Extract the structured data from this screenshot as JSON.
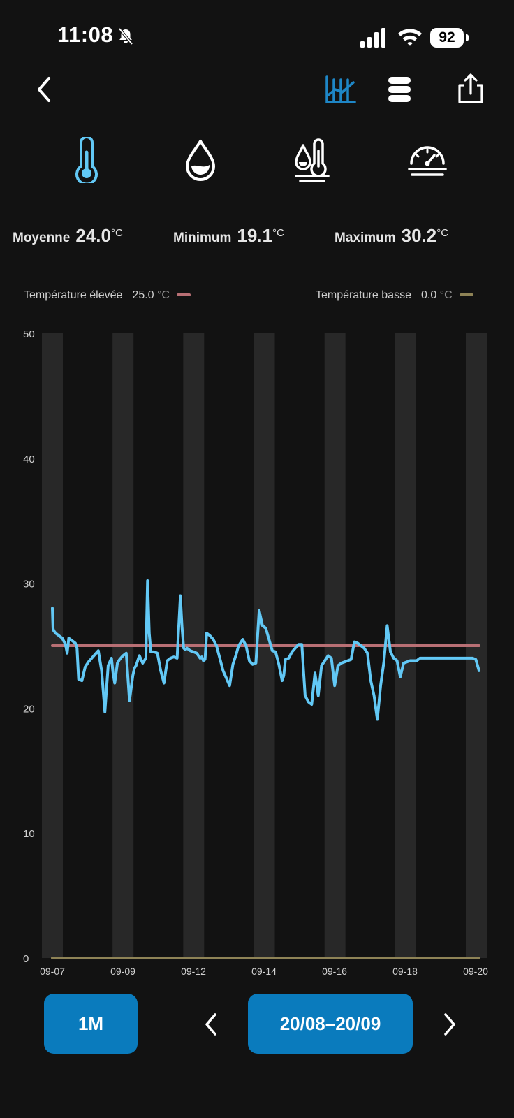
{
  "status_bar": {
    "time": "11:08",
    "battery": "92",
    "icons": [
      "bell-slash-icon",
      "cellular-signal-icon",
      "wifi-icon",
      "battery-icon"
    ]
  },
  "nav": {
    "icons": [
      "back-chevron-icon",
      "chart-view-icon",
      "list-view-icon",
      "share-icon"
    ]
  },
  "metric_tabs": [
    {
      "icon": "thermometer-icon",
      "active": true
    },
    {
      "icon": "water-drop-icon",
      "active": false
    },
    {
      "icon": "dew-point-icon",
      "active": false
    },
    {
      "icon": "gauge-icon",
      "active": false
    }
  ],
  "stats": {
    "avg": {
      "label": "Moyenne",
      "value": "24.0",
      "unit": "°C"
    },
    "min": {
      "label": "Minimum",
      "value": "19.1",
      "unit": "°C"
    },
    "max": {
      "label": "Maximum",
      "value": "30.2",
      "unit": "°C"
    }
  },
  "legend": {
    "high": {
      "label": "Température élevée",
      "value": "25.0",
      "unit": "°C",
      "color": "#b86f74"
    },
    "low": {
      "label": "Température basse",
      "value": "0.0",
      "unit": "°C",
      "color": "#8e8356"
    }
  },
  "controls": {
    "range": "1M",
    "date_range": "20/08–20/09"
  },
  "colors": {
    "accent": "#0a7bbd",
    "line": "#62c8f5",
    "band": "#282828",
    "background": "#121212"
  },
  "chart_data": {
    "type": "line",
    "ylim": [
      0,
      50
    ],
    "y_ticks": [
      "0",
      "10",
      "20",
      "30",
      "40",
      "50"
    ],
    "x_ticks": [
      "09-07",
      "09-09",
      "09-12",
      "09-14",
      "09-16",
      "09-18",
      "09-20"
    ],
    "thresholds": [
      {
        "value": 25.0,
        "color": "#b86f74"
      },
      {
        "value": 0.0,
        "color": "#8e8356"
      }
    ],
    "x_domain": [
      0,
      13
    ],
    "series": [
      {
        "x": [
          0,
          0.02,
          0.04,
          0.1,
          0.2,
          0.3,
          0.4,
          0.45,
          0.5,
          0.6,
          0.7,
          0.75,
          0.8,
          0.9,
          1.0,
          1.1,
          1.2,
          1.3,
          1.4,
          1.5,
          1.6,
          1.7,
          1.8,
          1.85,
          1.9,
          1.98,
          2.05,
          2.15,
          2.25,
          2.35,
          2.45,
          2.5,
          2.55,
          2.6,
          2.65,
          2.75,
          2.85,
          2.9,
          2.95,
          3.0,
          3.1,
          3.2,
          3.3,
          3.4,
          3.5,
          3.55,
          3.6,
          3.7,
          3.8,
          3.9,
          3.95,
          4.0,
          4.05,
          4.1,
          4.2,
          4.3,
          4.4,
          4.45,
          4.5,
          4.55,
          4.6,
          4.65,
          4.7,
          4.8,
          4.9,
          5.0,
          5.2,
          5.4,
          5.5,
          5.6,
          5.65,
          5.7,
          5.8,
          5.9,
          6.0,
          6.1,
          6.2,
          6.3,
          6.4,
          6.5,
          6.6,
          6.7,
          6.8,
          6.9,
          7.0,
          7.05,
          7.1,
          7.2,
          7.3,
          7.4,
          7.5,
          7.6,
          7.7,
          7.8,
          7.9,
          8.0,
          8.1,
          8.2,
          8.3,
          8.4,
          8.5,
          8.6,
          8.7,
          8.8,
          8.9,
          9.0,
          9.1,
          9.2,
          9.3,
          9.4,
          9.5,
          9.6,
          9.7,
          9.8,
          9.9,
          10.0,
          10.1,
          10.2,
          10.3,
          10.4,
          10.5,
          10.6,
          10.7,
          10.8,
          10.9,
          11.0,
          11.1,
          11.2,
          11.3,
          11.4,
          11.5,
          11.6,
          11.7,
          11.8,
          11.9,
          12.0,
          12.1,
          12.2,
          12.3,
          12.4,
          12.5,
          12.6,
          12.7,
          12.8,
          12.9,
          13.0
        ],
        "values": [
          28.0,
          26.4,
          26.2,
          26.0,
          25.8,
          25.6,
          25.1,
          24.4,
          25.6,
          25.4,
          25.2,
          24.8,
          22.3,
          22.2,
          23.3,
          23.7,
          24.0,
          24.3,
          24.6,
          23.0,
          19.7,
          23.4,
          24.0,
          22.8,
          22.0,
          23.6,
          23.9,
          24.2,
          24.4,
          20.6,
          22.6,
          23.2,
          23.4,
          23.8,
          24.2,
          23.6,
          24.0,
          30.2,
          26.0,
          24.5,
          24.5,
          24.4,
          23.0,
          22.0,
          23.8,
          23.9,
          24.0,
          24.1,
          24.0,
          29.0,
          26.5,
          24.8,
          24.7,
          24.8,
          24.6,
          24.5,
          24.4,
          24.2,
          24.0,
          24.1,
          23.8,
          23.9,
          26.0,
          25.8,
          25.5,
          25.0,
          23.0,
          21.8,
          23.5,
          24.3,
          24.8,
          25.1,
          25.5,
          25.0,
          23.8,
          23.5,
          23.6,
          27.8,
          26.6,
          26.4,
          25.5,
          24.6,
          24.5,
          23.5,
          22.2,
          22.6,
          23.9,
          24.0,
          24.5,
          24.8,
          25.1,
          25.1,
          21.0,
          20.5,
          20.3,
          22.8,
          21.0,
          23.4,
          23.8,
          24.2,
          24.0,
          21.8,
          23.4,
          23.6,
          23.7,
          23.8,
          23.9,
          25.3,
          25.2,
          25.0,
          24.8,
          24.4,
          22.2,
          21.0,
          19.1,
          21.8,
          23.7,
          26.6,
          24.5,
          24.0,
          23.8,
          22.5,
          23.6,
          23.7,
          23.8,
          23.8,
          23.8,
          24.0,
          24.0,
          24.0,
          24.0,
          24.0,
          24.0,
          24.0,
          24.0,
          24.0,
          24.0,
          24.0,
          24.0,
          24.0,
          24.0,
          24.0,
          24.0,
          24.0,
          23.9,
          23.0
        ]
      }
    ]
  }
}
